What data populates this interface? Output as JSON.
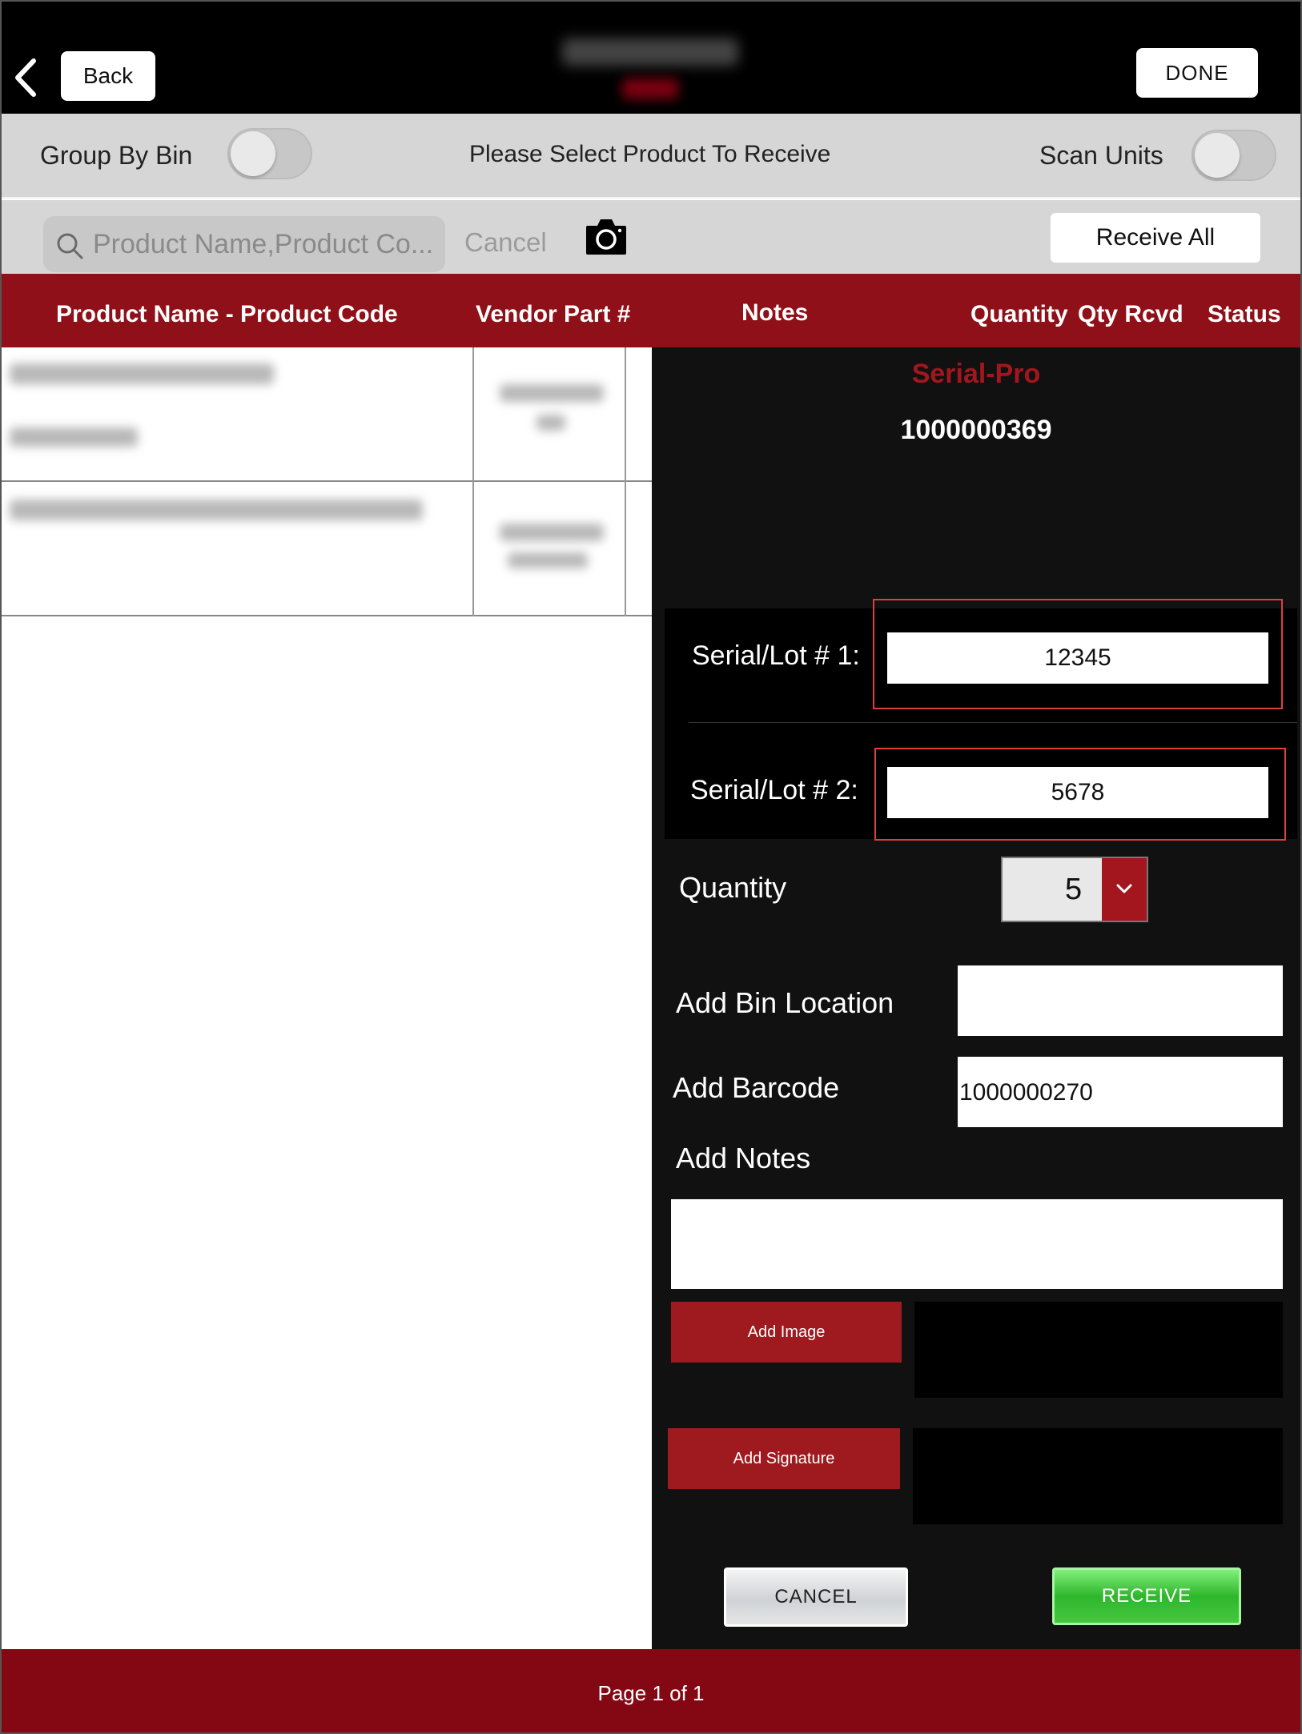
{
  "header": {
    "back_label": "Back",
    "done_label": "DONE"
  },
  "toolbar": {
    "group_by_bin_label": "Group By Bin",
    "group_by_bin_on": false,
    "instruction": "Please Select Product To Receive",
    "scan_units_label": "Scan Units",
    "scan_units_on": false
  },
  "search": {
    "placeholder": "Product Name,Product Co...",
    "cancel_label": "Cancel",
    "receive_all_label": "Receive All"
  },
  "table": {
    "columns": [
      "Product Name - Product Code",
      "Vendor Part #",
      "Notes",
      "Quantity",
      "Qty Rcvd",
      "Status"
    ]
  },
  "detail": {
    "product_name": "Serial-Pro",
    "product_code": "1000000369",
    "serial_1_label": "Serial/Lot # 1:",
    "serial_1_value": "12345",
    "serial_2_label": "Serial/Lot # 2:",
    "serial_2_value": "5678",
    "quantity_label": "Quantity",
    "quantity_value": "5",
    "bin_label": "Add Bin Location",
    "bin_value": "",
    "barcode_label": "Add Barcode",
    "barcode_value": "1000000270",
    "notes_label": "Add Notes",
    "notes_value": "",
    "add_image_label": "Add Image",
    "add_signature_label": "Add Signature",
    "cancel_label": "CANCEL",
    "receive_label": "RECEIVE"
  },
  "footer": {
    "page_label": "Page 1 of 1"
  },
  "colors": {
    "brand_red": "#8f1018",
    "footer_red": "#840814",
    "receive_green": "#2fb62c"
  }
}
